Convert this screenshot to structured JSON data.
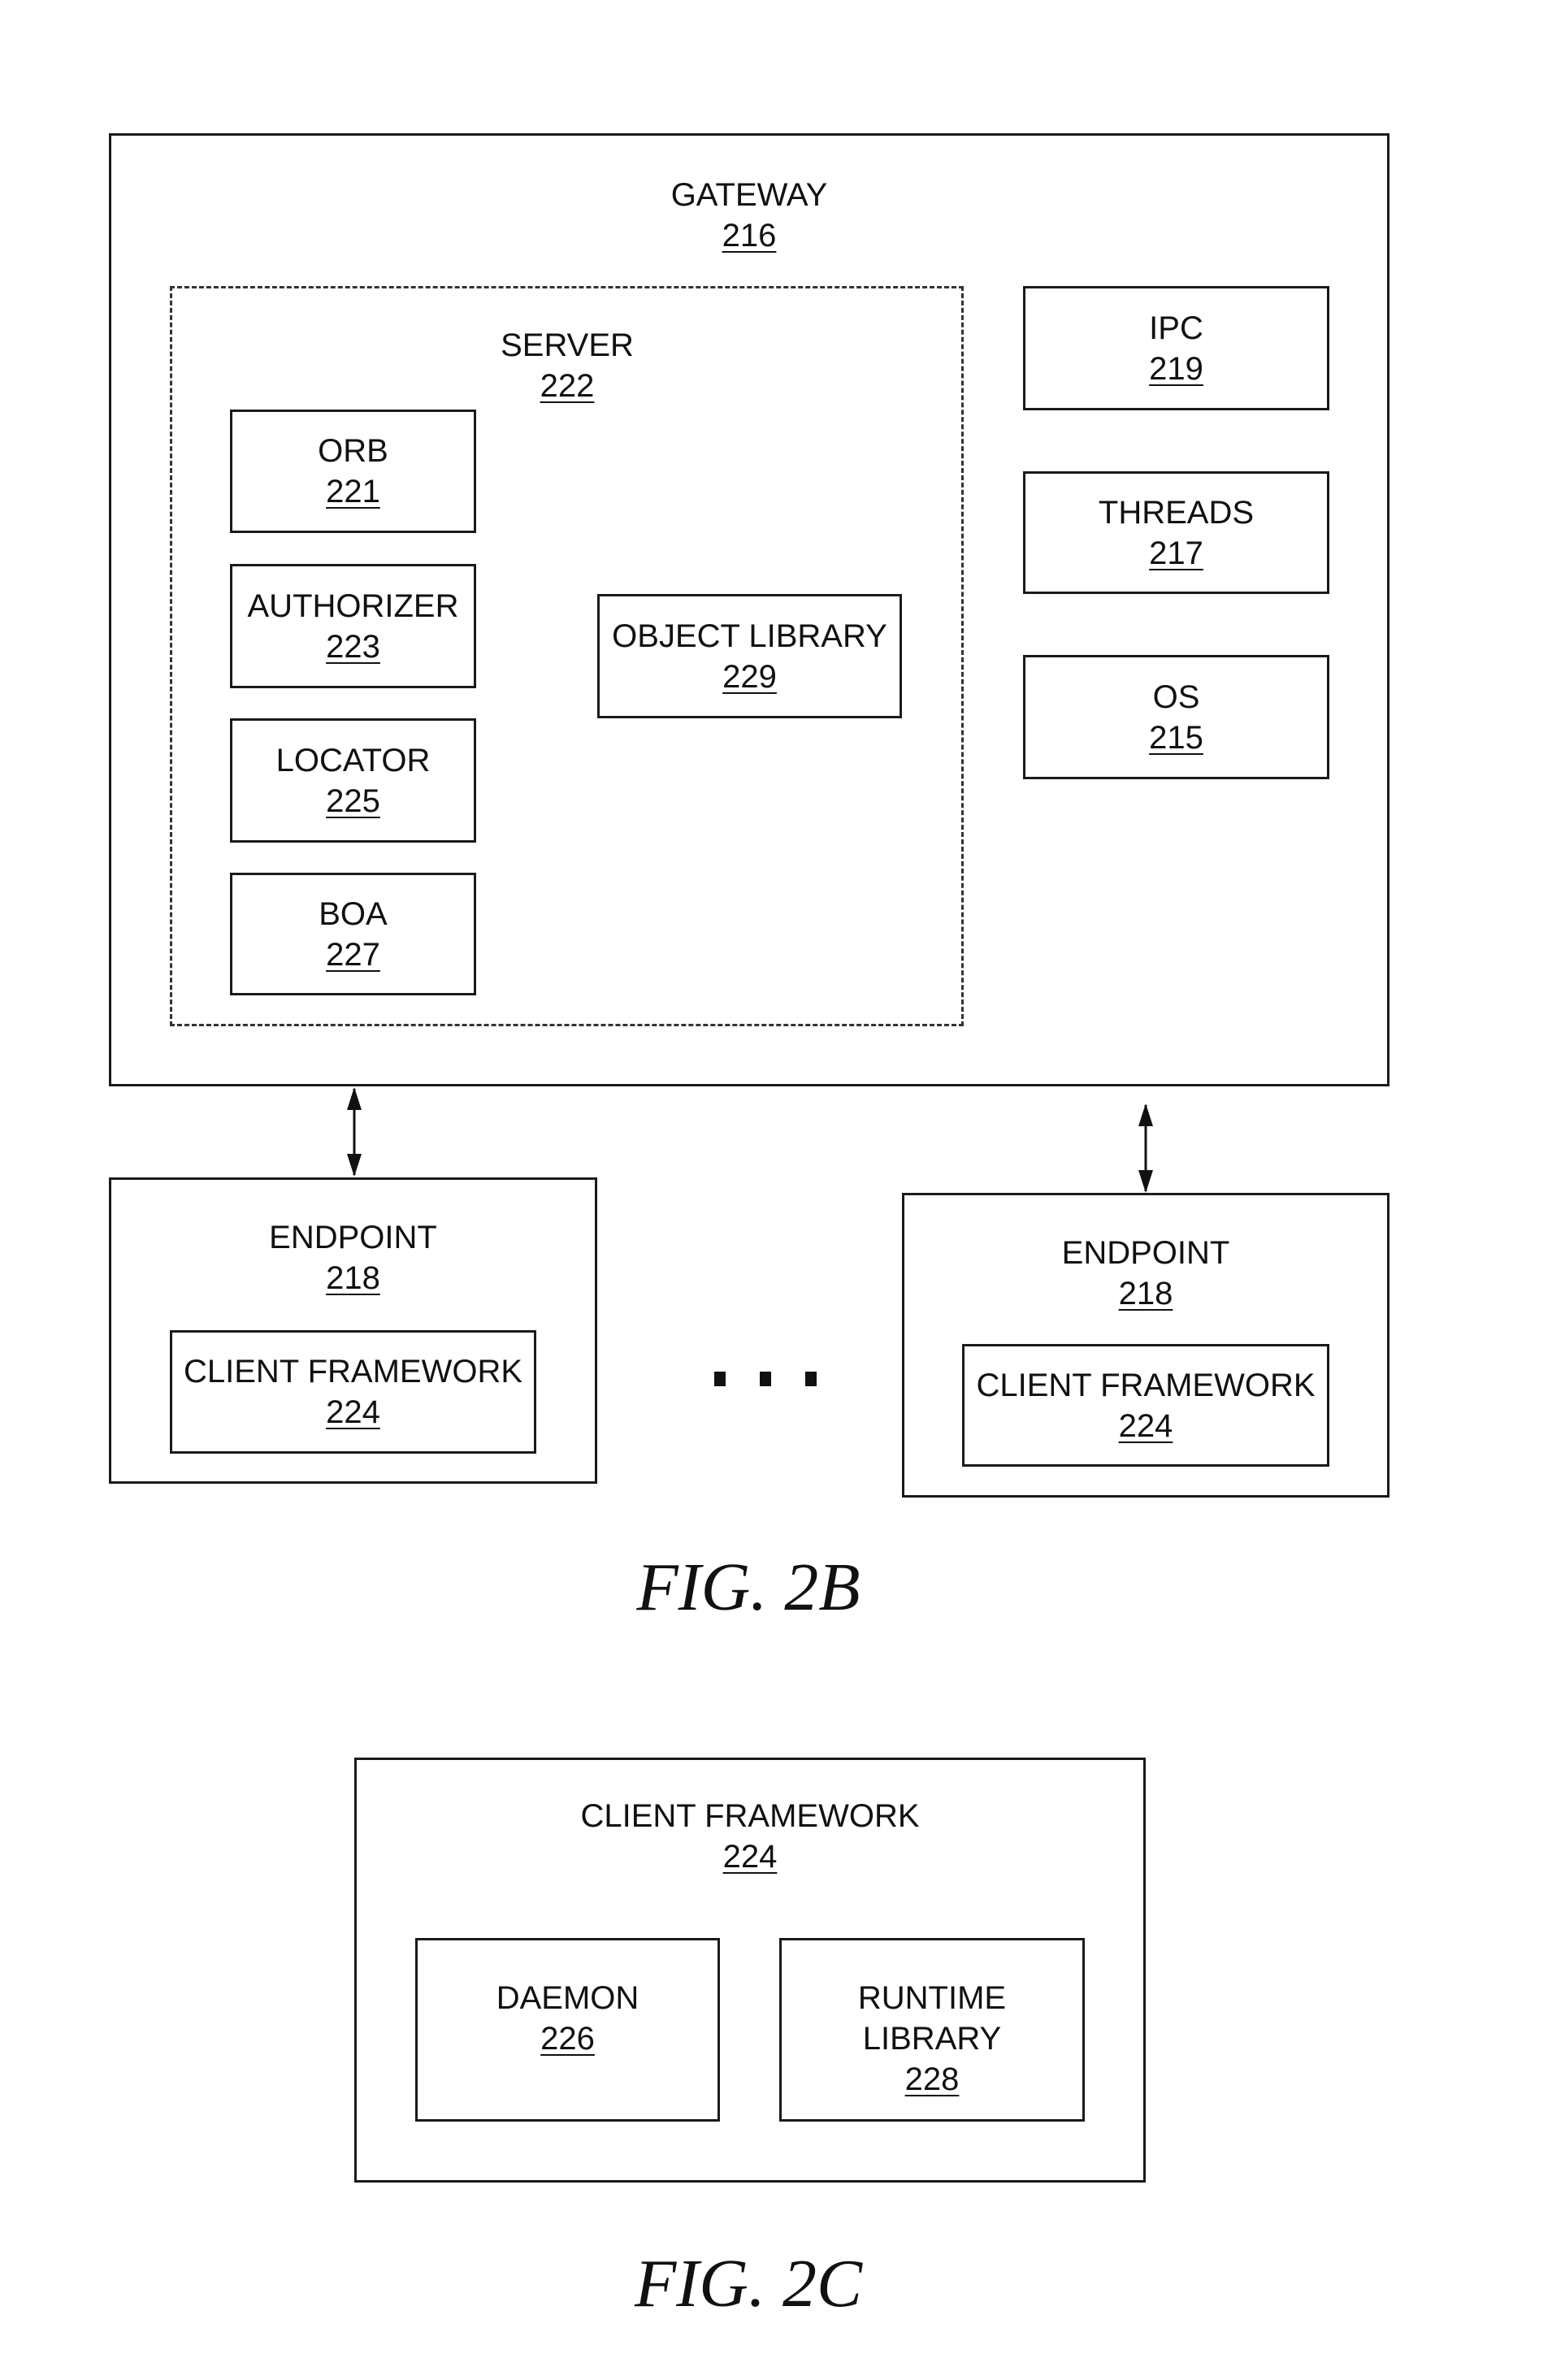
{
  "fig2b": {
    "caption": "FIG. 2B",
    "gateway": {
      "label": "GATEWAY",
      "number": "216",
      "server": {
        "label": "SERVER",
        "number": "222",
        "components": [
          {
            "label": "ORB",
            "number": "221"
          },
          {
            "label": "AUTHORIZER",
            "number": "223"
          },
          {
            "label": "LOCATOR",
            "number": "225"
          },
          {
            "label": "BOA",
            "number": "227"
          }
        ],
        "object_library": {
          "label": "OBJECT LIBRARY",
          "number": "229"
        }
      },
      "side_components": [
        {
          "label": "IPC",
          "number": "219"
        },
        {
          "label": "THREADS",
          "number": "217"
        },
        {
          "label": "OS",
          "number": "215"
        }
      ]
    },
    "endpoints": [
      {
        "label": "ENDPOINT",
        "number": "218",
        "client_framework": {
          "label": "CLIENT FRAMEWORK",
          "number": "224"
        }
      },
      {
        "label": "ENDPOINT",
        "number": "218",
        "client_framework": {
          "label": "CLIENT FRAMEWORK",
          "number": "224"
        }
      }
    ],
    "ellipsis": "..."
  },
  "fig2c": {
    "caption": "FIG. 2C",
    "client_framework": {
      "label": "CLIENT FRAMEWORK",
      "number": "224",
      "daemon": {
        "label": "DAEMON",
        "number": "226"
      },
      "runtime_library": {
        "line1": "RUNTIME",
        "line2": "LIBRARY",
        "number": "228"
      }
    }
  }
}
